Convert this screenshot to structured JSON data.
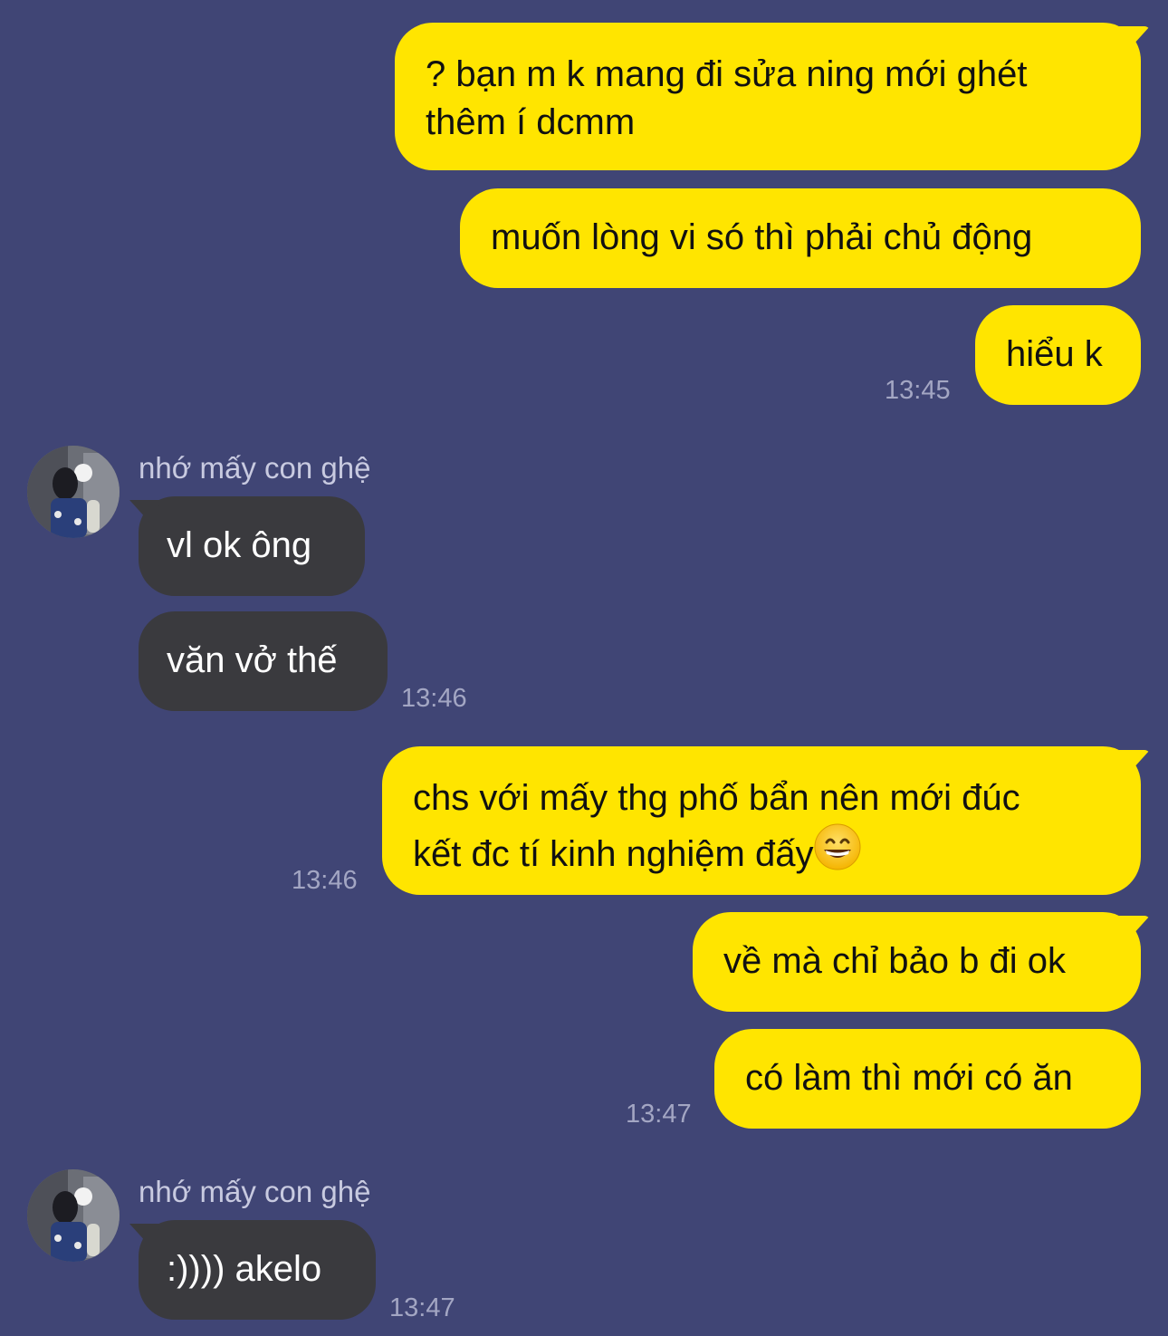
{
  "conversation": {
    "messages": [
      {
        "text": "? bạn m k mang đi sửa ning mới ghét thêm í dcmm"
      },
      {
        "text": "muốn lòng vi só thì phải chủ động"
      },
      {
        "text": "hiểu k",
        "time": "13:45"
      },
      {
        "sender": "nhớ mấy con ghệ",
        "text": "vl ok ông"
      },
      {
        "text": "văn vở thế",
        "time": "13:46"
      },
      {
        "text_line1": "chs với mấy thg phố bẩn nên mới đúc",
        "text_line2": "kết đc tí kinh nghiệm đấy",
        "emoji": "grinning-face-with-smiling-eyes",
        "time": "13:46"
      },
      {
        "text": "về mà chỉ bảo b đi ok"
      },
      {
        "text": "có làm thì mới có ăn",
        "time": "13:47"
      },
      {
        "sender": "nhớ mấy con ghệ",
        "text": ":)))) akelo",
        "time": "13:47"
      }
    ]
  },
  "colors": {
    "background": "#404575",
    "my_bubble": "#FFE500",
    "their_bubble": "#3A3A3E",
    "timestamp": "#A3A6C3"
  }
}
